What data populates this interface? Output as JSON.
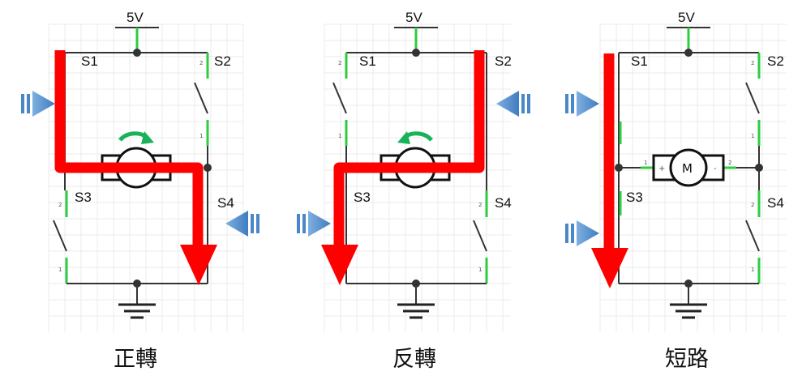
{
  "supply_label": "5V",
  "switch_labels": [
    "S1",
    "S2",
    "S3",
    "S4"
  ],
  "pin_labels": {
    "one": "1",
    "two": "2"
  },
  "motor": {
    "symbol": "M",
    "plus": "+",
    "minus": "-"
  },
  "panels": [
    {
      "caption": "正轉",
      "mode": "forward",
      "closed": [
        "S1",
        "S4"
      ],
      "rotation": "clockwise"
    },
    {
      "caption": "反轉",
      "mode": "reverse",
      "closed": [
        "S2",
        "S3"
      ],
      "rotation": "counterclockwise"
    },
    {
      "caption": "短路",
      "mode": "short",
      "closed": [
        "S1",
        "S3"
      ],
      "rotation": "none"
    }
  ],
  "colors": {
    "current_path": "#ff0000",
    "push_arrow": "#4a86c8",
    "rotation_arrow": "#19b25a",
    "active_wire": "#2ecc40",
    "wire": "#333333"
  }
}
